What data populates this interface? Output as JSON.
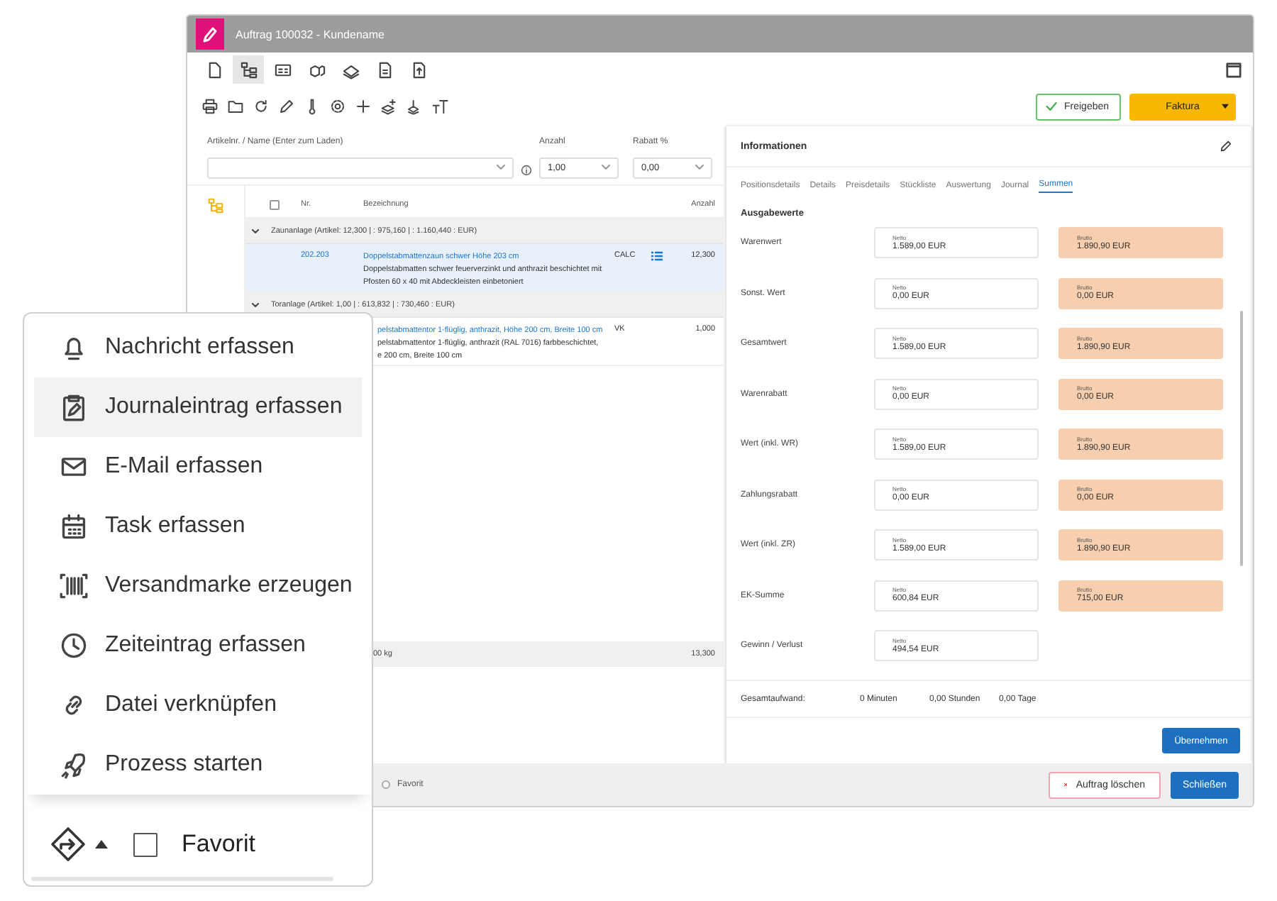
{
  "window": {
    "title": "Auftrag 100032 - Kundename"
  },
  "view_tabs": [
    {
      "selected": false
    },
    {
      "selected": true
    },
    {
      "selected": false
    },
    {
      "selected": false
    },
    {
      "selected": false
    },
    {
      "selected": false
    },
    {
      "selected": false
    }
  ],
  "actions": [
    {
      "kind": "approve",
      "label": "Freigeben"
    },
    {
      "kind": "menu",
      "label": "Faktura"
    }
  ],
  "article_entry": {
    "article": {
      "label": "Artikelnr. / Name (Enter zum Laden)"
    },
    "quantity": {
      "label": "Anzahl",
      "value": "1,00"
    },
    "discount": {
      "label": "Rabatt %",
      "value": "0,00"
    }
  },
  "positions": {
    "columns": [
      "Nr.",
      "Bezeichnung",
      "Anzahl"
    ],
    "all_checked": false,
    "rows": [
      {
        "kind": "group",
        "expanded": true,
        "label": "Zaunanlage (Artikel: 12,300 | : 975,160 | : 1.160,440 : EUR)"
      },
      {
        "kind": "item",
        "selected": true,
        "number": "202.203",
        "title": "Doppelstabmattenzaun schwer Höhe 203 cm",
        "description": [
          "Doppelstabmatten schwer feuerverzinkt und anthrazit beschichtet mit",
          "Pfosten 60 x 40 mit Abdeckleisten einbetoniert"
        ],
        "type": "CALC",
        "list_icon": true,
        "quantity": "12,300"
      },
      {
        "kind": "group",
        "expanded": true,
        "label": "Toranlage (Artikel: 1,00 | : 613,832 | : 730,460 : EUR)"
      },
      {
        "kind": "item",
        "selected": false,
        "title": "pelstabmattentor 1-flüglig, anthrazit, Höhe 200 cm, Breite 100 cm",
        "description": [
          "pelstabmattentor 1-flüglig, anthrazit (RAL 7016) farbbeschichtet,",
          "e 200 cm, Breite 100 cm"
        ],
        "type": "VK",
        "list_icon": false,
        "quantity": "1,000"
      }
    ],
    "total": {
      "weight": "00 kg",
      "quantity": "13,300"
    }
  },
  "favorite": {
    "label": "Favorit",
    "checked": false
  },
  "footer_buttons": [
    {
      "kind": "danger",
      "label": "Auftrag löschen"
    },
    {
      "kind": "primary",
      "label": "Schließen"
    }
  ],
  "info_panel": {
    "title": "Informationen",
    "tabs": [
      {
        "label": "Positionsdetails",
        "selected": false
      },
      {
        "label": "Details",
        "selected": false
      },
      {
        "label": "Preisdetails",
        "selected": false
      },
      {
        "label": "Stückliste",
        "selected": false
      },
      {
        "label": "Auswertung",
        "selected": false
      },
      {
        "label": "Journal",
        "selected": false
      },
      {
        "label": "Summen",
        "selected": true
      }
    ],
    "section": "Ausgabewerte",
    "values": [
      {
        "label": "Warenwert",
        "net": {
          "label": "Netto",
          "value": "1.589,00 EUR"
        },
        "gross": {
          "label": "Brutto",
          "value": "1.890,90 EUR"
        }
      },
      {
        "label": "Sonst. Wert",
        "net": {
          "label": "Netto",
          "value": "0,00 EUR"
        },
        "gross": {
          "label": "Brutto",
          "value": "0,00 EUR"
        }
      },
      {
        "label": "Gesamtwert",
        "net": {
          "label": "Netto",
          "value": "1.589,00 EUR"
        },
        "gross": {
          "label": "Brutto",
          "value": "1.890,90 EUR"
        }
      },
      {
        "label": "Warenrabatt",
        "net": {
          "label": "Netto",
          "value": "0,00 EUR"
        },
        "gross": {
          "label": "Brutto",
          "value": "0,00 EUR"
        }
      },
      {
        "label": "Wert (inkl. WR)",
        "net": {
          "label": "Netto",
          "value": "1.589,00 EUR"
        },
        "gross": {
          "label": "Brutto",
          "value": "1.890,90 EUR"
        }
      },
      {
        "label": "Zahlungsrabatt",
        "net": {
          "label": "Netto",
          "value": "0,00 EUR"
        },
        "gross": {
          "label": "Brutto",
          "value": "0,00 EUR"
        }
      },
      {
        "label": "Wert (inkl. ZR)",
        "net": {
          "label": "Netto",
          "value": "1.589,00 EUR"
        },
        "gross": {
          "label": "Brutto",
          "value": "1.890,90 EUR"
        }
      },
      {
        "label": "EK-Summe",
        "net": {
          "label": "Netto",
          "value": "600,84 EUR"
        },
        "gross": {
          "label": "Brutto",
          "value": "715,00 EUR"
        }
      },
      {
        "label": "Gewinn / Verlust",
        "net": {
          "label": "Netto",
          "value": "494,54 EUR"
        }
      }
    ],
    "effort": {
      "label": "Gesamtaufwand:",
      "minutes": "0 Minuten",
      "hours": "0,00 Stunden",
      "days": "0,00 Tage"
    },
    "apply_button": "Übernehmen"
  },
  "action_menu": {
    "items": [
      {
        "label": "Nachricht erfassen",
        "selected": false
      },
      {
        "label": "Journaleintrag erfassen",
        "selected": true
      },
      {
        "label": "E-Mail erfassen",
        "selected": false
      },
      {
        "label": "Task erfassen",
        "selected": false
      },
      {
        "label": "Versandmarke erzeugen",
        "selected": false
      },
      {
        "label": "Zeiteintrag erfassen",
        "selected": false
      },
      {
        "label": "Datei verknüpfen",
        "selected": false
      },
      {
        "label": "Prozess starten",
        "selected": false
      }
    ],
    "favorite": {
      "label": "Favorit",
      "checked": false
    }
  }
}
